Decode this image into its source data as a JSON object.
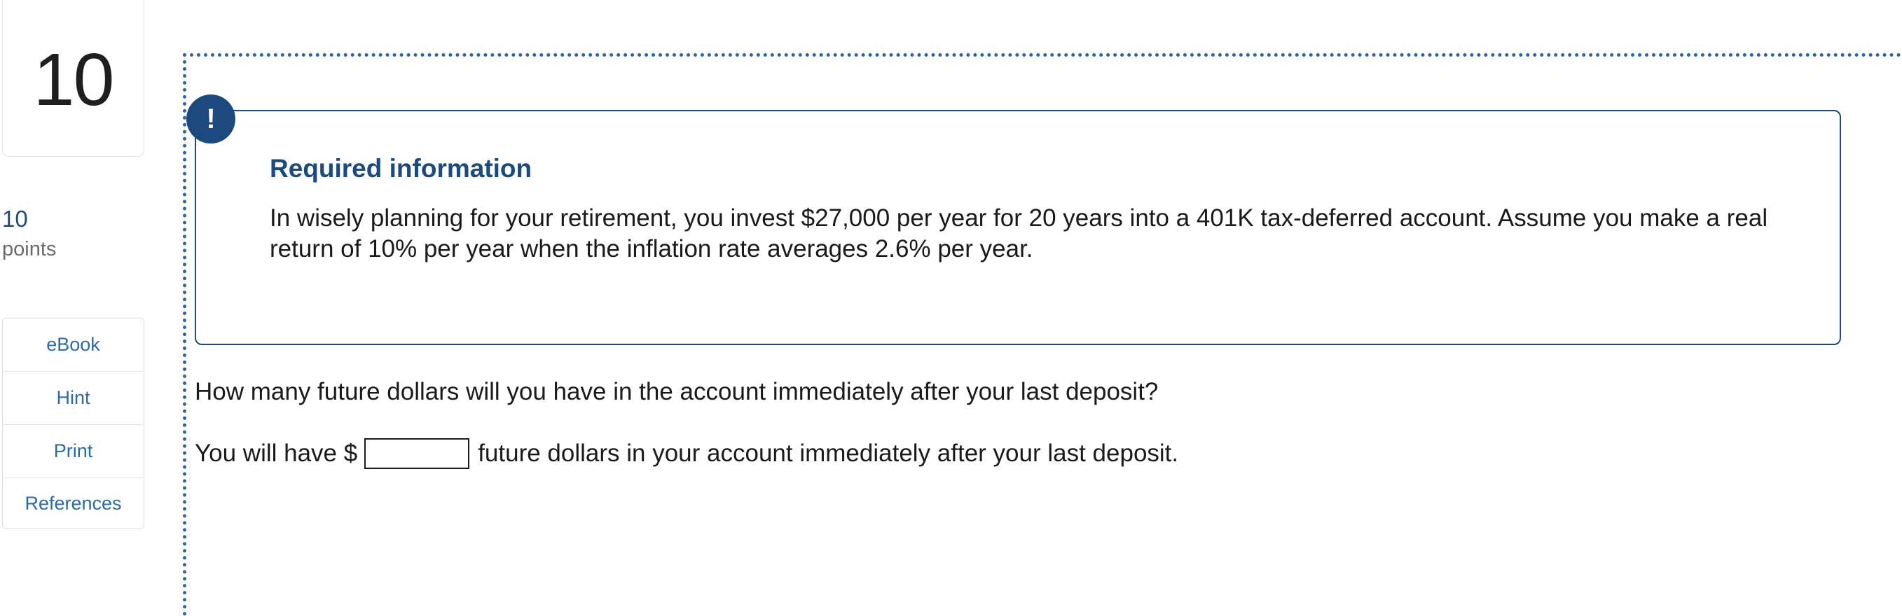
{
  "question": {
    "number": "10",
    "points_value": "10",
    "points_label": "points"
  },
  "tools": [
    {
      "label": "eBook"
    },
    {
      "label": "Hint"
    },
    {
      "label": "Print"
    },
    {
      "label": "References"
    }
  ],
  "required_info": {
    "icon": "exclamation-icon",
    "icon_glyph": "!",
    "title": "Required information",
    "body": "In wisely planning for your retirement, you invest $27,000 per year for 20 years into a 401K tax-deferred account. Assume you make a real return of 10% per year when the inflation rate averages 2.6% per year."
  },
  "prompt": {
    "question_text": "How many future dollars will you have in the account immediately after your last deposit?",
    "answer_prefix": "You will have $",
    "answer_value": "",
    "answer_suffix": "future dollars in your account immediately after your last deposit."
  },
  "colors": {
    "accent": "#1c4a7f",
    "link": "#2b6aa8",
    "dotted_frame": "#2e63a8"
  }
}
